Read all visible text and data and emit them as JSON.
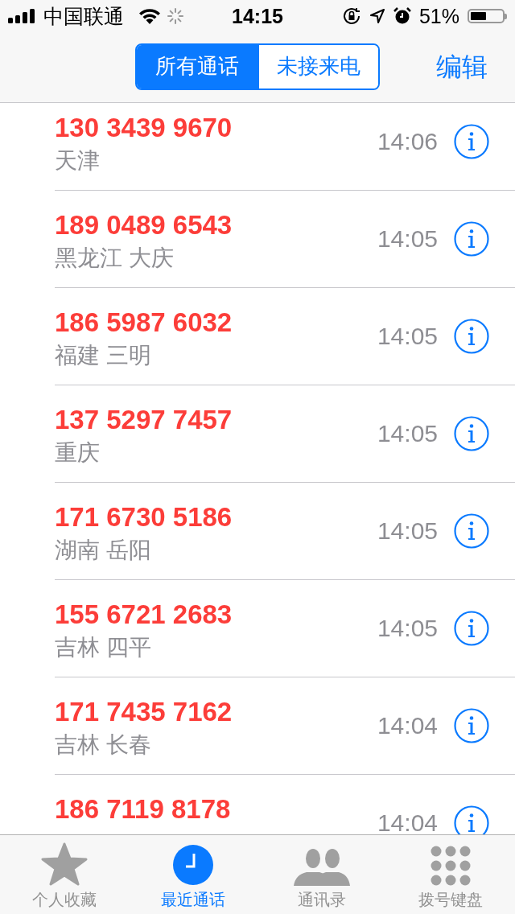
{
  "status_bar": {
    "carrier": "中国联通",
    "time": "14:15",
    "battery": "51%",
    "battery_indicator": {
      "level": 0.51
    }
  },
  "nav": {
    "segments": [
      {
        "label": "所有通话",
        "selected": true
      },
      {
        "label": "未接来电",
        "selected": false
      }
    ],
    "edit": "编辑"
  },
  "calls": [
    {
      "number": "130 3439 9670",
      "location": "天津",
      "time": "14:06",
      "missed": true
    },
    {
      "number": "189 0489 6543",
      "location": "黑龙江 大庆",
      "time": "14:05",
      "missed": true
    },
    {
      "number": "186 5987 6032",
      "location": "福建 三明",
      "time": "14:05",
      "missed": true
    },
    {
      "number": "137 5297 7457",
      "location": "重庆",
      "time": "14:05",
      "missed": true
    },
    {
      "number": "171 6730 5186",
      "location": "湖南 岳阳",
      "time": "14:05",
      "missed": true
    },
    {
      "number": "155 6721 2683",
      "location": "吉林 四平",
      "time": "14:05",
      "missed": true
    },
    {
      "number": "171 7435 7162",
      "location": "吉林 长春",
      "time": "14:04",
      "missed": true
    },
    {
      "number": "186 7119 8178",
      "time": "14:04",
      "missed": true
    }
  ],
  "tab_bar": [
    {
      "label": "个人收藏",
      "kind": "star",
      "selected": false
    },
    {
      "label": "最近通话",
      "kind": "clock",
      "selected": true
    },
    {
      "label": "通讯录",
      "kind": "people",
      "selected": false
    },
    {
      "label": "拨号键盘",
      "kind": "keypad",
      "selected": false
    }
  ]
}
